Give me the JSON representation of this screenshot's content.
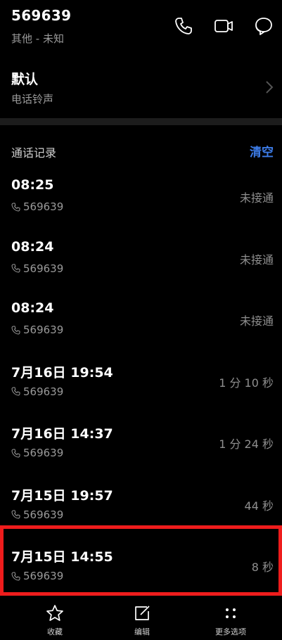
{
  "contact": {
    "number": "569639",
    "subtitle": "其他 - 未知"
  },
  "header_icons": [
    "phone-icon",
    "video-call-icon",
    "message-icon"
  ],
  "ringtone": {
    "title": "默认",
    "subtitle": "电话铃声"
  },
  "call_history": {
    "title": "通话记录",
    "clear_label": "清空",
    "items": [
      {
        "time": "08:25",
        "number": "569639",
        "status": "未接通"
      },
      {
        "time": "08:24",
        "number": "569639",
        "status": "未接通"
      },
      {
        "time": "08:24",
        "number": "569639",
        "status": "未接通"
      },
      {
        "time": "7月16日 19:54",
        "number": "569639",
        "status": "1 分 10 秒"
      },
      {
        "time": "7月16日 14:37",
        "number": "569639",
        "status": "1 分 24 秒"
      },
      {
        "time": "7月15日 19:57",
        "number": "569639",
        "status": "44 秒"
      },
      {
        "time": "7月15日 14:55",
        "number": "569639",
        "status": "8 秒"
      }
    ]
  },
  "bottom_bar": {
    "favorite_label": "收藏",
    "edit_label": "编辑",
    "more_label": "更多选项"
  },
  "colors": {
    "accent": "#3d7ce8",
    "highlight": "#ee1c1c"
  }
}
